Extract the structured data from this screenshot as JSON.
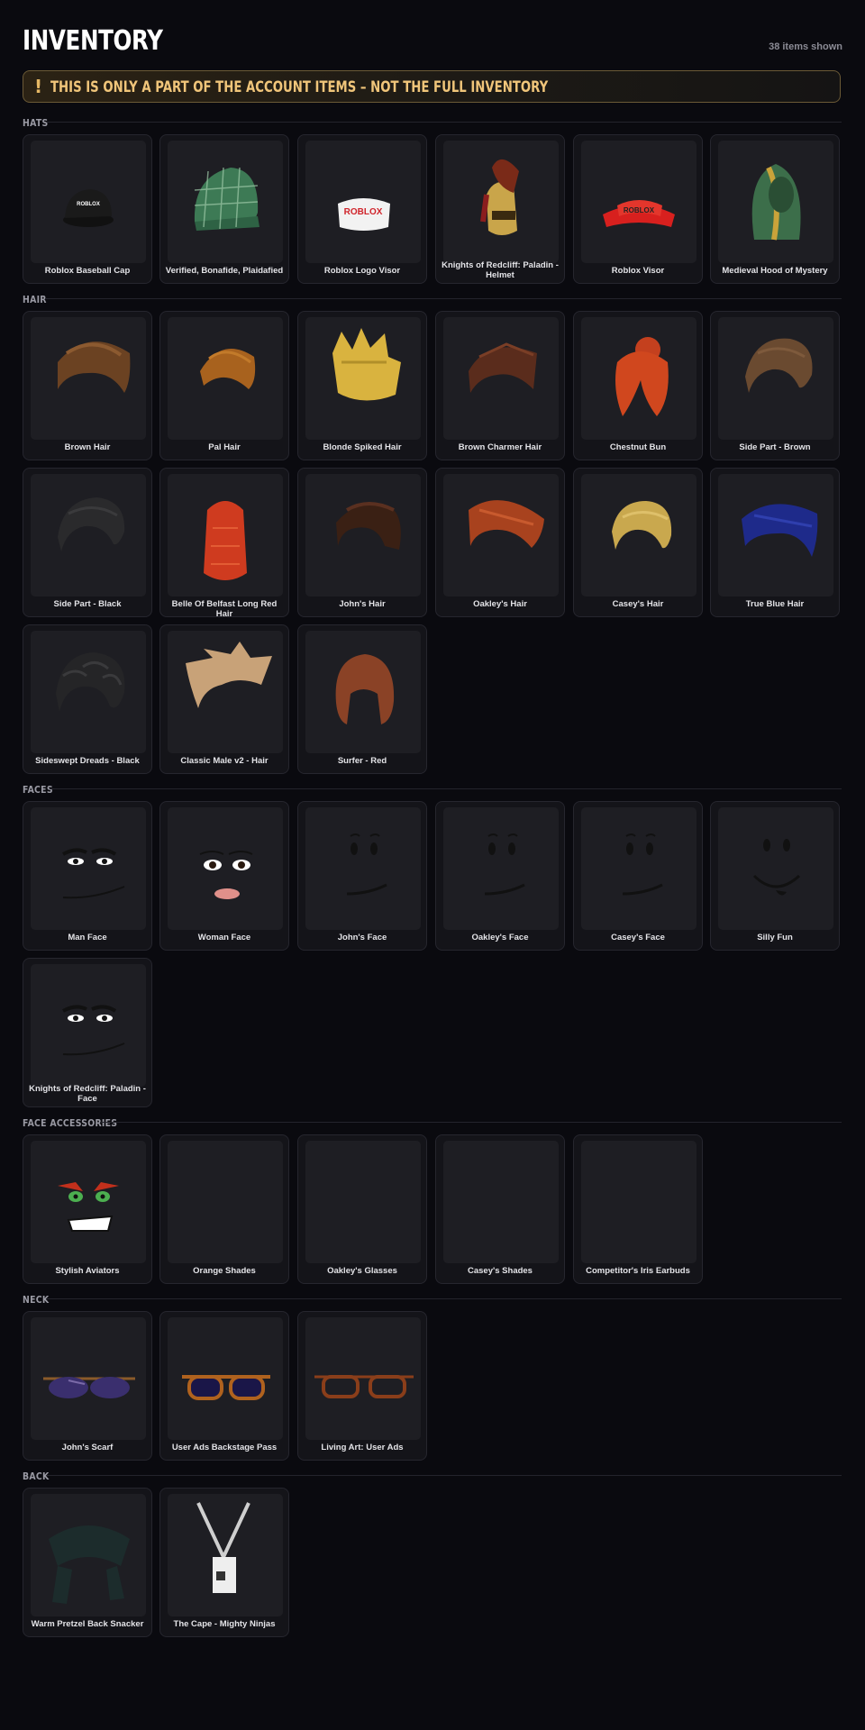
{
  "header": {
    "title": "INVENTORY",
    "count": "38 items shown"
  },
  "warning": {
    "icon": "!",
    "text": "THIS IS ONLY A PART OF THE ACCOUNT ITEMS – NOT THE FULL INVENTORY"
  },
  "colors": {
    "background": "#0a0a0f",
    "card": "#141419",
    "thumb": "#1e1e23",
    "warning_text": "#f0c57a",
    "warning_border": "#6b5a36"
  },
  "sections": [
    {
      "label": "HATS",
      "items": [
        {
          "name": "Roblox Baseball Cap",
          "icon": "black-cap"
        },
        {
          "name": "Verified, Bonafide, Plaidafied",
          "icon": "green-plaid-cap"
        },
        {
          "name": "Roblox Logo Visor",
          "icon": "white-visor"
        },
        {
          "name": "Knights of Redcliff: Paladin - Helmet",
          "icon": "paladin-helmet"
        },
        {
          "name": "Roblox Visor",
          "icon": "red-visor"
        },
        {
          "name": "Medieval Hood of Mystery",
          "icon": "green-hood"
        }
      ]
    },
    {
      "label": "HAIR",
      "items": [
        {
          "name": "Brown Hair",
          "icon": "hair"
        },
        {
          "name": "Pal Hair",
          "icon": "hair"
        },
        {
          "name": "Blonde Spiked Hair",
          "icon": "hair"
        },
        {
          "name": "Brown Charmer Hair",
          "icon": "hair"
        },
        {
          "name": "Chestnut Bun",
          "icon": "hair"
        },
        {
          "name": "Side Part - Brown",
          "icon": "hair"
        },
        {
          "name": "Side Part - Black",
          "icon": "hair"
        },
        {
          "name": "Belle Of Belfast Long Red Hair",
          "icon": "hair"
        },
        {
          "name": "John's Hair",
          "icon": "hair"
        },
        {
          "name": "Oakley's Hair",
          "icon": "hair"
        },
        {
          "name": "Casey's Hair",
          "icon": "hair"
        },
        {
          "name": "True Blue Hair",
          "icon": "hair"
        },
        {
          "name": "Sideswept Dreads - Black",
          "icon": "hair"
        },
        {
          "name": "Classic Male v2 - Hair",
          "icon": "hair"
        },
        {
          "name": "Surfer - Red",
          "icon": "hair"
        }
      ]
    },
    {
      "label": "FACES",
      "items": [
        {
          "name": "Man Face",
          "icon": "face"
        },
        {
          "name": "Woman Face",
          "icon": "face"
        },
        {
          "name": "John's Face",
          "icon": "face"
        },
        {
          "name": "Oakley's Face",
          "icon": "face"
        },
        {
          "name": "Casey's Face",
          "icon": "face"
        },
        {
          "name": "Silly Fun",
          "icon": "face"
        },
        {
          "name": "Knights of Redcliff: Paladin - Face",
          "icon": "face"
        }
      ]
    },
    {
      "label": "FACE ACCESSORIES",
      "items": [
        {
          "name": "Stylish Aviators",
          "icon": "glasses"
        },
        {
          "name": "Orange Shades",
          "icon": "glasses"
        },
        {
          "name": "Oakley's Glasses",
          "icon": "glasses"
        },
        {
          "name": "Casey's Shades",
          "icon": "glasses"
        },
        {
          "name": "Competitor's Iris Earbuds",
          "icon": "earbuds"
        }
      ]
    },
    {
      "label": "NECK",
      "items": [
        {
          "name": "John's Scarf",
          "icon": "scarf"
        },
        {
          "name": "User Ads Backstage Pass",
          "icon": "lanyard"
        },
        {
          "name": "Living Art: User Ads",
          "icon": "picture-frame"
        }
      ]
    },
    {
      "label": "BACK",
      "items": [
        {
          "name": "Warm Pretzel Back Snacker",
          "icon": "pretzel"
        },
        {
          "name": "The Cape - Mighty Ninjas",
          "icon": "green-cape"
        }
      ]
    }
  ]
}
